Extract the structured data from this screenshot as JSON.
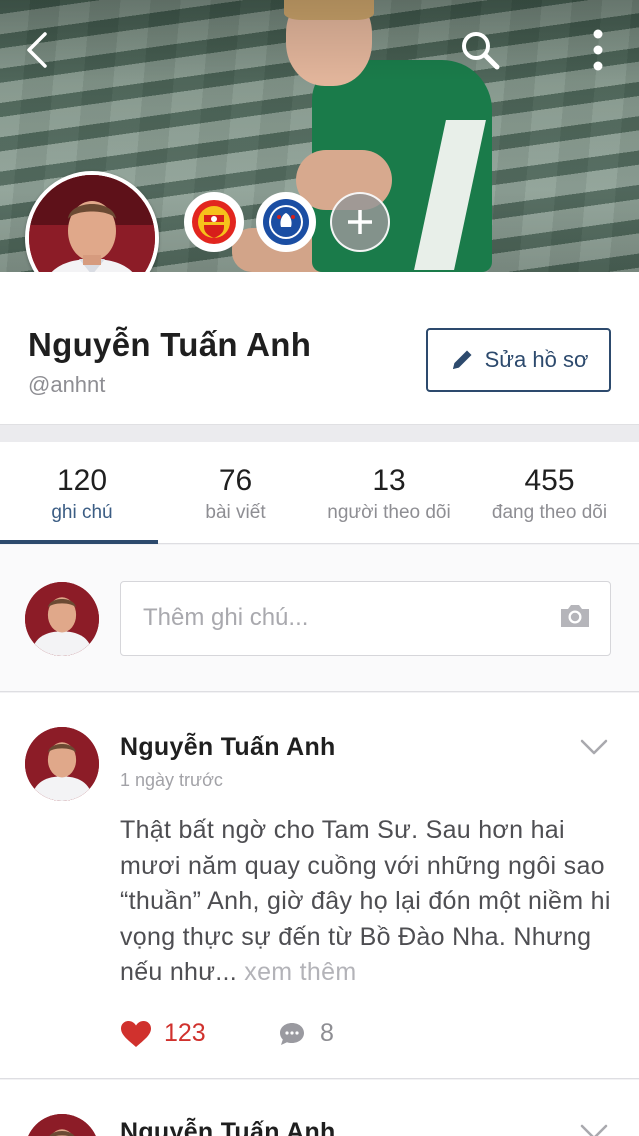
{
  "cover": {
    "back_icon": "chevron-left-icon",
    "search_icon": "search-icon",
    "more_icon": "more-vertical-icon"
  },
  "clubs": [
    {
      "name": "Manchester United",
      "icon": "club-badge-icon"
    },
    {
      "name": "Chelsea",
      "icon": "club-badge-icon"
    }
  ],
  "profile": {
    "name": "Nguyễn Tuấn Anh",
    "handle": "@anhnt",
    "edit_label": "Sửa hồ sơ"
  },
  "stats": [
    {
      "value": "120",
      "label": "ghi chú",
      "active": true
    },
    {
      "value": "76",
      "label": "bài viết"
    },
    {
      "value": "13",
      "label": "người theo dõi"
    },
    {
      "value": "455",
      "label": "đang theo dõi"
    }
  ],
  "compose": {
    "placeholder": "Thêm ghi chú..."
  },
  "posts": [
    {
      "author": "Nguyễn Tuấn Anh",
      "time": "1 ngày trước",
      "body": "Thật bất ngờ cho Tam Sư. Sau hơn hai mươi năm quay cuồng với những ngôi sao “thuần” Anh, giờ đây họ lại đón một niềm hi vọng thực sự đến từ Bồ Đào Nha. Nhưng nếu như...",
      "more": "xem thêm",
      "likes": "123",
      "comments": "8"
    },
    {
      "author": "Nguyễn Tuấn Anh"
    }
  ],
  "colors": {
    "accent": "#2d4a6d",
    "like": "#d0312d",
    "muted": "#8e8e93"
  }
}
